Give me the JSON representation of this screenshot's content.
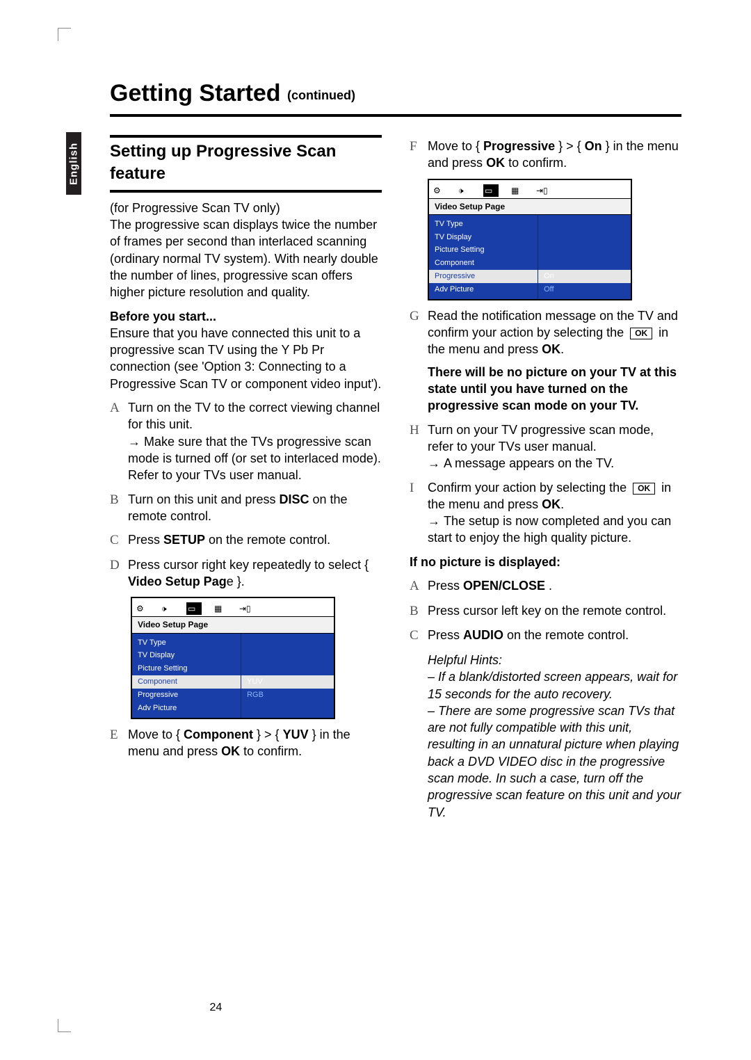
{
  "page": {
    "number": "24",
    "title_main": "Getting Started",
    "title_cont": "(continued)",
    "lang_tab": "English"
  },
  "left": {
    "heading": "Setting up Progressive Scan feature",
    "intro": "(for Progressive Scan TV only)\nThe progressive scan displays twice the number of frames per second than interlaced scanning (ordinary normal TV system). With nearly double the number of lines, progressive scan offers higher picture resolution and quality.",
    "before_label": "Before you start...",
    "before_body": "Ensure that you have connected this unit to a progressive scan TV using the Y Pb Pr connection (see 'Option 3: Connecting to a Progressive Scan TV or component video input').",
    "steps": {
      "A": {
        "text": "Turn on the TV to the correct viewing channel for this unit.",
        "sub": "Make sure that the TVs progressive scan mode is turned off (or set to interlaced mode). Refer to your TVs user manual."
      },
      "B": {
        "pre": "Turn on this unit and press ",
        "bold": "DISC",
        "post": " on the remote control."
      },
      "C": {
        "pre": "Press ",
        "bold": "SETUP",
        "post": " on the remote control."
      },
      "D": {
        "pre": "Press cursor right key repeatedly to select { ",
        "bold": "Video Setup Pag",
        "post2": "e }."
      },
      "E": {
        "pre": "Move to { ",
        "b1": "Component",
        "mid": " } > { ",
        "b2": "YUV",
        "post": " } in the menu and press ",
        "b3": "OK",
        "post2": " to confirm."
      }
    }
  },
  "right": {
    "steps": {
      "F": {
        "pre": "Move to { ",
        "b1": "Progressive",
        "mid": " } > { ",
        "b2": "On",
        "post": " } in the menu and press ",
        "b3": "OK",
        "post2": " to confirm."
      },
      "G": {
        "text": "Read the notification message on the TV and confirm your action by selecting the",
        "ok": "OK",
        "post": " in the menu and press ",
        "b": "OK",
        "post2": "."
      },
      "warn": "There will be no picture on your TV at this state until you have turned on the progressive scan mode on your TV.",
      "H": {
        "text": "Turn on your TV progressive scan mode, refer to your TVs user manual.",
        "sub": "A message appears on the TV."
      },
      "I": {
        "text": "Confirm your action by selecting the",
        "ok": "OK",
        "post": " in the menu and press ",
        "b": "OK",
        "post2": ".",
        "sub": "The setup is now completed and you can start to enjoy the high quality picture."
      }
    },
    "nopic_label": "If no picture is displayed:",
    "nopic": {
      "A": {
        "pre": "Press ",
        "b": "OPEN/CLOSE",
        "post": "    ."
      },
      "B": "Press cursor left key on the remote control.",
      "C": {
        "pre": "Press ",
        "b": "AUDIO",
        "post": " on the remote control."
      }
    },
    "hints_label": "Helpful Hints:",
    "hint1": "– If a blank/distorted screen appears, wait for 15 seconds for the auto recovery.",
    "hint2": "– There are some progressive scan TVs that are not fully compatible with this unit, resulting in an unnatural picture when playing back a DVD VIDEO disc in the progressive scan mode. In such a case, turn off the progressive scan feature on this unit and your TV."
  },
  "osd1": {
    "title": "Video Setup Page",
    "menu": [
      "TV Type",
      "TV Display",
      "Picture Setting",
      "Component",
      "Progressive",
      "Adv Picture"
    ],
    "highlight": "Component",
    "opts": [
      "YUV",
      "RGB"
    ],
    "opt_align_index": 3
  },
  "osd2": {
    "title": "Video Setup Page",
    "menu": [
      "TV Type",
      "TV Display",
      "Picture Setting",
      "Component",
      "Progressive",
      "Adv Picture"
    ],
    "highlight": "Progressive",
    "opts": [
      "On",
      "Off"
    ],
    "opt_align_index": 4
  },
  "icons": {
    "general": "⚙",
    "audio": "🔊",
    "video": "▭",
    "pref": "▦",
    "lock": "🔒"
  }
}
